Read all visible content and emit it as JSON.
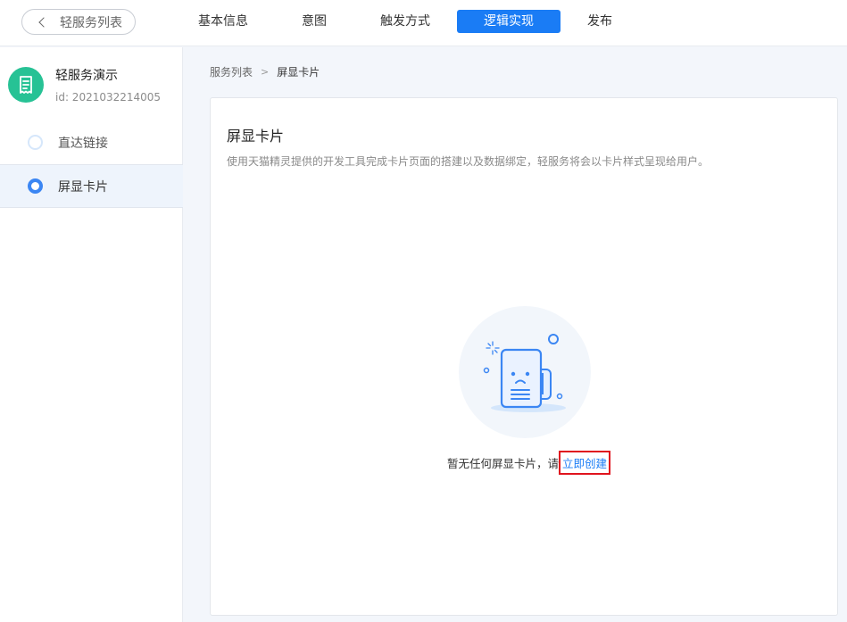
{
  "topbar": {
    "back_label": "轻服务列表",
    "tabs": [
      {
        "label": "基本信息"
      },
      {
        "label": "意图"
      },
      {
        "label": "触发方式"
      },
      {
        "label": "逻辑实现"
      },
      {
        "label": "发布"
      }
    ],
    "active_tab": "逻辑实现"
  },
  "sidebar": {
    "app_name": "轻服务演示",
    "app_id": "id: 2021032214005",
    "avatar_icon": "document-icon",
    "items": [
      {
        "label": "直达链接"
      },
      {
        "label": "屏显卡片"
      }
    ],
    "selected_item": "屏显卡片"
  },
  "breadcrumb": {
    "parent": "服务列表",
    "separator": ">",
    "current": "屏显卡片"
  },
  "card": {
    "title": "屏显卡片",
    "description": "使用天猫精灵提供的开发工具完成卡片页面的搭建以及数据绑定，轻服务将会以卡片样式呈现给用户。",
    "empty_text": "暂无任何屏显卡片，请",
    "create_link": "立即创建",
    "empty_icon": "empty-document-icon"
  },
  "colors": {
    "accent": "#1a7cf5",
    "avatar": "#27c295",
    "highlight_border": "#e0141e"
  }
}
